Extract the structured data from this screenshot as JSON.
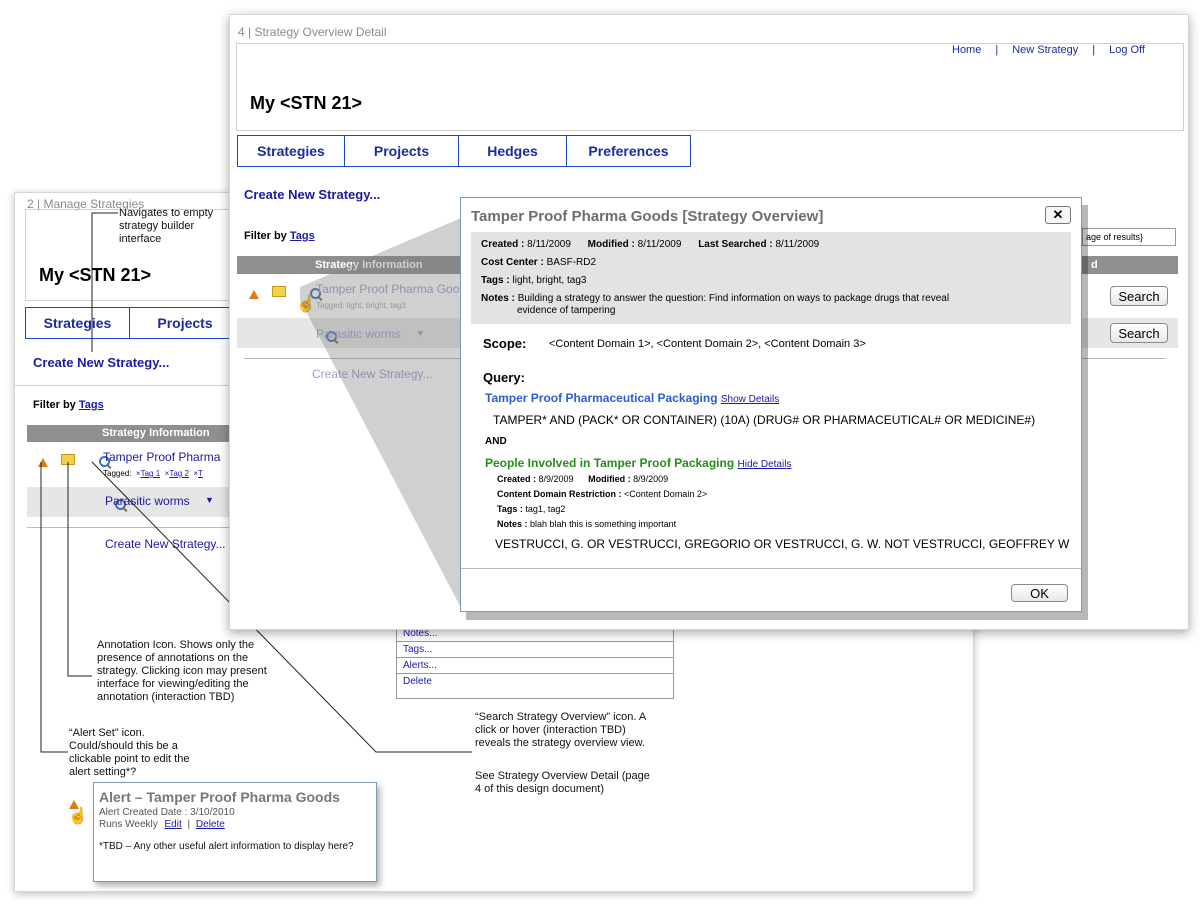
{
  "back": {
    "page_label": "2 | Manage Strategies",
    "annotation_top": "Navigates to empty strategy builder interface",
    "title": "My <STN 21>",
    "tabs": [
      "Strategies",
      "Projects"
    ],
    "create_link": "Create New Strategy...",
    "filter_label": "Filter by",
    "filter_link": "Tags",
    "column_header": "Strategy Information",
    "row1_title": "Tamper Proof Pharma",
    "row1_tagged": "Tagged:",
    "row1_tags": [
      "Tag 1",
      "Tag 2",
      "T"
    ],
    "row2_title": "Parasitic worms",
    "create_link_bottom": "Create New Strategy...",
    "menu_items": [
      "Notes...",
      "Tags...",
      "Alerts...",
      "Delete"
    ],
    "anno_annotation": "Annotation Icon.  Shows only the presence of annotations on the strategy. Clicking icon may present interface for viewing/editing the annotation (interaction TBD)",
    "anno_alert": "“Alert Set” icon. Could/should this be a clickable point to edit the alert setting*?",
    "anno_search_1": "“Search Strategy Overview” icon. A click or hover (interaction TBD) reveals the strategy overview view.",
    "anno_search_2": "See Strategy Overview Detail (page 4 of this design document)"
  },
  "alert_popup": {
    "title": "Alert – Tamper Proof Pharma Goods",
    "created": "Alert Created Date  : 3/10/2010",
    "runs": "Runs Weekly",
    "edit": "Edit",
    "sep": "|",
    "delete": "Delete",
    "tbd": "*TBD – Any other useful alert information to display here?"
  },
  "front": {
    "page_label": "4 | Strategy Overview Detail",
    "nav": [
      "Home",
      "New Strategy",
      "Log Off"
    ],
    "nav_sep": "|",
    "title": "My <STN 21>",
    "tabs": [
      "Strategies",
      "Projects",
      "Hedges",
      "Preferences"
    ],
    "create_link": "Create New Strategy...",
    "filter_label": "Filter by",
    "filter_link": "Tags",
    "column_header": "Strategy Information",
    "row1_title": "Tamper Proof Pharma Goods",
    "row1_tagged": "Tagged: light, bright, tag3",
    "row2_title": "Parasitic worms",
    "create_link_bottom": "Create New Strategy...",
    "right_field": "age of results}",
    "right_header": "d",
    "search_button": "Search"
  },
  "overlay": {
    "title": "Tamper Proof Pharma Goods [Strategy Overview]",
    "close": "✕",
    "created_label": "Created :",
    "created": "8/11/2009",
    "modified_label": "Modified :",
    "modified": "8/11/2009",
    "searched_label": "Last Searched :",
    "searched": "8/11/2009",
    "cost_label": "Cost Center :",
    "cost": "BASF-RD2",
    "tags_label": "Tags :",
    "tags": "light, bright, tag3",
    "notes_label": "Notes :",
    "notes_1": "Building a strategy to answer the question: Find information on ways to package drugs that reveal",
    "notes_2": "evidence of tampering",
    "scope_label": "Scope:",
    "scope": "<Content Domain 1>, <Content Domain 2>, <Content Domain 3>",
    "query_label": "Query:",
    "q1_title": "Tamper Proof Pharmaceutical Packaging",
    "q1_link": "Show Details",
    "q1_text": "TAMPER* AND (PACK* OR CONTAINER) (10A) (DRUG# OR PHARMACEUTICAL# OR MEDICINE#)",
    "and": "AND",
    "q2_title": "People Involved in Tamper Proof Packaging",
    "q2_link": "Hide Details",
    "q2_created_label": "Created :",
    "q2_created": "8/9/2009",
    "q2_modified_label": "Modified :",
    "q2_modified": "8/9/2009",
    "q2_cdr_label": "Content Domain Restriction :",
    "q2_cdr": "<Content Domain 2>",
    "q2_tags_label": "Tags :",
    "q2_tags": "tag1, tag2",
    "q2_notes_label": "Notes :",
    "q2_notes": "blah blah this is something important",
    "q2_text": "VESTRUCCI, G. OR VESTRUCCI, GREGORIO OR VESTRUCCI, G. W.  NOT VESTRUCCI, GEOFFREY W",
    "ok": "OK"
  }
}
